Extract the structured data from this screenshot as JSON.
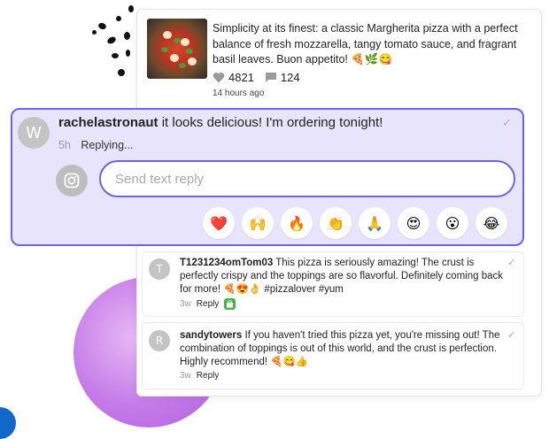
{
  "post": {
    "caption": "Simplicity at its finest: a classic Margherita pizza with a perfect balance of fresh mozzarella, tangy tomato sauce, and fragrant basil leaves. Buon appetito! 🍕🌿😋",
    "likes": "4821",
    "comments": "124",
    "time": "14 hours ago",
    "icons": [
      "heart-icon",
      "comment-icon"
    ]
  },
  "active_comment": {
    "avatar_letter": "W",
    "author": "rachelastronaut",
    "text": " it looks delicious! I'm ordering tonight!",
    "age": "5h",
    "status": "Replying...",
    "check": "✓"
  },
  "reply": {
    "placeholder": "Send text reply",
    "value": "",
    "emojis": [
      "❤️",
      "🙌",
      "🔥",
      "👏",
      "🙏",
      "😍",
      "😮",
      "😂"
    ]
  },
  "comments": [
    {
      "avatar_letter": "T",
      "author": "T1231234omTom03",
      "text": " This pizza is seriously amazing! The crust is perfectly crispy and the toppings are so flavorful. Definitely coming back for more! 🍕😍👌 #pizzalover #yum",
      "age": "3w",
      "reply_label": "Reply",
      "check": "✓"
    },
    {
      "avatar_letter": "R",
      "author": "sandytowers",
      "text": " If you haven't tried this pizza yet, you're missing out! The combination of toppings is out of this world, and the crust is perfection. Highly recommend! 🍕😋👍",
      "age": "3w",
      "reply_label": "Reply",
      "check": "✓"
    }
  ],
  "colors": {
    "accent": "#6c63e8",
    "active_bg": "#e7e4fb",
    "avatar": "#c4c4c4",
    "store_badge": "#44b549"
  }
}
